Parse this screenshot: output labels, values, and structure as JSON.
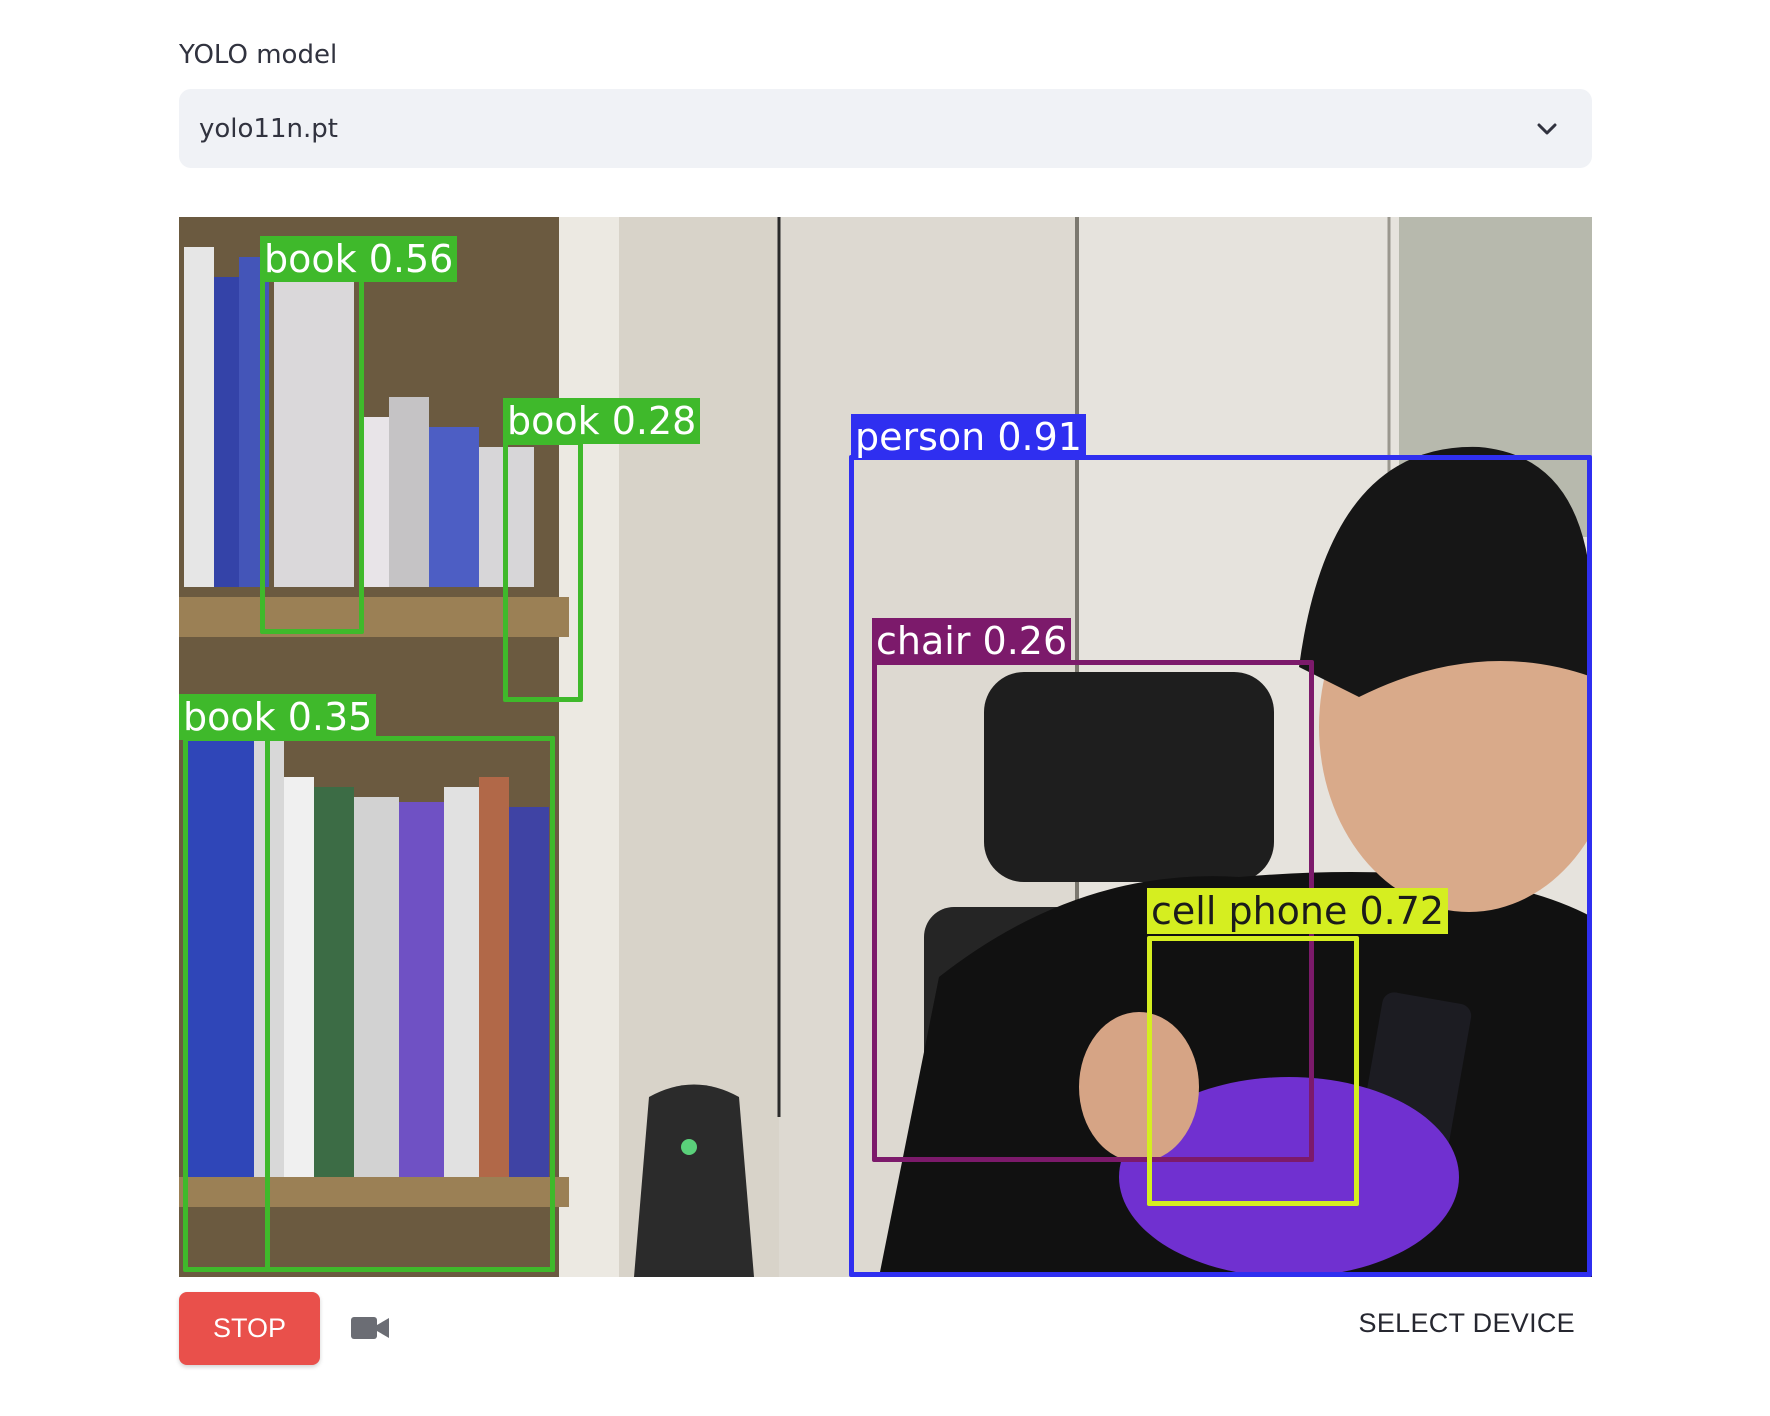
{
  "model_select": {
    "label": "YOLO model",
    "value": "yolo11n.pt",
    "icon": "chevron-down-icon"
  },
  "video": {
    "detections": [
      {
        "label": "book 0.56",
        "color": "#3fb92b"
      },
      {
        "label": "book 0.28",
        "color": "#3fb92b"
      },
      {
        "label": "book 0.35",
        "color": "#3fb92b"
      },
      {
        "label": "person 0.91",
        "color": "#2f2ff0"
      },
      {
        "label": "chair 0.26",
        "color": "#7c1a6b"
      },
      {
        "label": "cell phone 0.72",
        "color": "#d5ee20"
      }
    ]
  },
  "controls": {
    "stop_label": "STOP",
    "stop_color": "#e9504b",
    "camera_icon": "video-camera-icon",
    "select_device_label": "SELECT DEVICE"
  }
}
